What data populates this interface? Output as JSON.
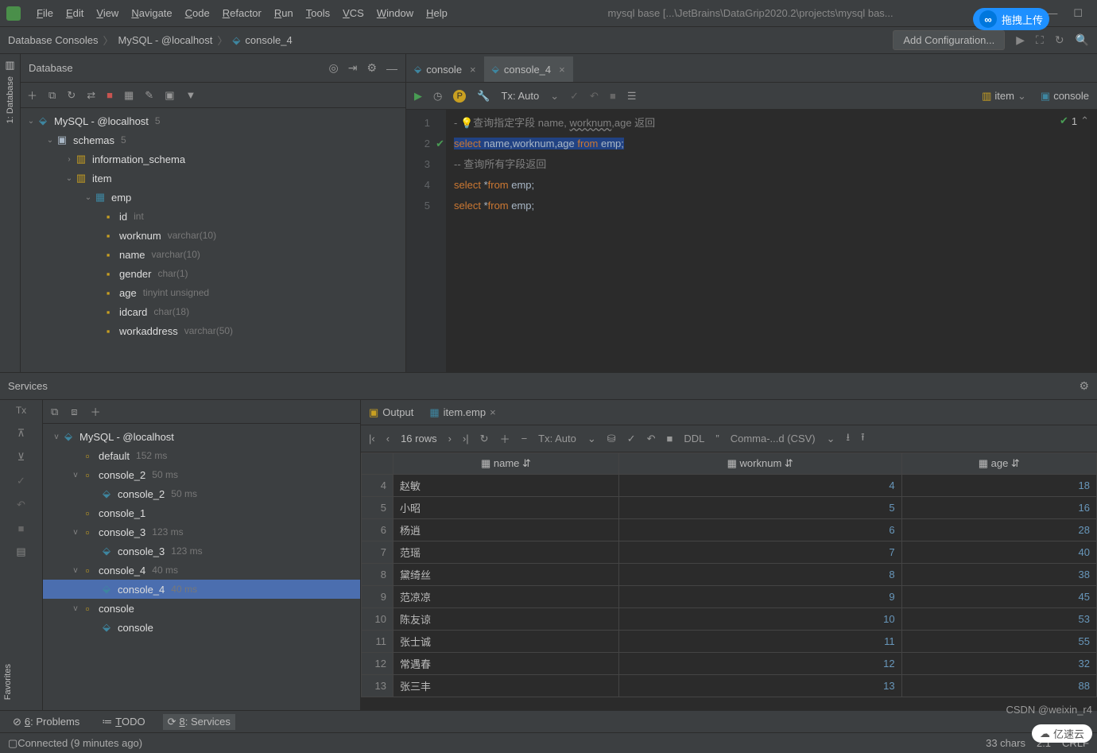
{
  "window": {
    "title": "mysql base [...\\JetBrains\\DataGrip2020.2\\projects\\mysql bas...",
    "float_button": "拖拽上传"
  },
  "menubar": [
    "File",
    "Edit",
    "View",
    "Navigate",
    "Code",
    "Refactor",
    "Run",
    "Tools",
    "VCS",
    "Window",
    "Help"
  ],
  "breadcrumb": [
    "Database Consoles",
    "MySQL - @localhost",
    "console_4"
  ],
  "config": "Add Configuration...",
  "left_tab": "1: Database",
  "db_panel": {
    "title": "Database",
    "tree": {
      "root": "MySQL - @localhost",
      "root_badge": "5",
      "schemas": "schemas",
      "schemas_badge": "5",
      "info": "information_schema",
      "item": "item",
      "emp": "emp",
      "cols": [
        {
          "n": "id",
          "t": "int"
        },
        {
          "n": "worknum",
          "t": "varchar(10)"
        },
        {
          "n": "name",
          "t": "varchar(10)"
        },
        {
          "n": "gender",
          "t": "char(1)"
        },
        {
          "n": "age",
          "t": "tinyint unsigned"
        },
        {
          "n": "idcard",
          "t": "char(18)"
        },
        {
          "n": "workaddress",
          "t": "varchar(50)"
        }
      ]
    }
  },
  "editor_tabs": [
    {
      "label": "console",
      "active": false
    },
    {
      "label": "console_4",
      "active": true
    }
  ],
  "editor_tb": {
    "tx": "Tx: Auto",
    "item": "item",
    "console": "console"
  },
  "code_lines": [
    {
      "n": 1,
      "type": "cm",
      "text": "查询指定字段 ",
      "extra": "name, ",
      "under": "worknum",
      "tail": ",age 返回",
      "bulb": true
    },
    {
      "n": 2,
      "type": "sel",
      "kw1": "select",
      "ids": " name,worknum,age ",
      "kw2": "from",
      "tbl": " emp",
      "semi": ";",
      "hl": true,
      "mark": true
    },
    {
      "n": 3,
      "type": "cm2",
      "text": "-- 查询所有字段返回"
    },
    {
      "n": 4,
      "type": "sel2",
      "kw1": "select",
      "star": " *",
      "kw2": "from",
      "tbl": " emp",
      "semi": ";"
    },
    {
      "n": 5,
      "type": "sel2",
      "kw1": "select",
      "star": " *",
      "kw2": "from",
      "tbl": " emp",
      "semi": ";"
    }
  ],
  "code_badge": "1",
  "services": {
    "title": "Services",
    "tree": [
      {
        "ind": 0,
        "exp": "v",
        "ico": "⬙",
        "label": "MySQL - @localhost",
        "hint": ""
      },
      {
        "ind": 1,
        "exp": "",
        "ico": "▫",
        "label": "default",
        "hint": "152 ms"
      },
      {
        "ind": 1,
        "exp": "v",
        "ico": "▫",
        "label": "console_2",
        "hint": "50 ms"
      },
      {
        "ind": 2,
        "exp": "",
        "ico": "⬙",
        "label": "console_2",
        "hint": "50 ms"
      },
      {
        "ind": 1,
        "exp": "",
        "ico": "▫",
        "label": "console_1",
        "hint": ""
      },
      {
        "ind": 1,
        "exp": "v",
        "ico": "▫",
        "label": "console_3",
        "hint": "123 ms"
      },
      {
        "ind": 2,
        "exp": "",
        "ico": "⬙",
        "label": "console_3",
        "hint": "123 ms"
      },
      {
        "ind": 1,
        "exp": "v",
        "ico": "▫",
        "label": "console_4",
        "hint": "40 ms"
      },
      {
        "ind": 2,
        "exp": "",
        "ico": "⬙",
        "label": "console_4",
        "hint": "40 ms",
        "sel": true
      },
      {
        "ind": 1,
        "exp": "v",
        "ico": "▫",
        "label": "console",
        "hint": ""
      },
      {
        "ind": 2,
        "exp": "",
        "ico": "⬙",
        "label": "console",
        "hint": ""
      }
    ],
    "output_tab": "Output",
    "table_tab": "item.emp",
    "rowcount": "16 rows",
    "tx": "Tx: Auto",
    "ddl": "DDL",
    "csv": "Comma-...d (CSV)",
    "columns": [
      "name",
      "worknum",
      "age"
    ],
    "rows": [
      {
        "rn": 4,
        "name": "赵敏",
        "worknum": "4",
        "age": "18"
      },
      {
        "rn": 5,
        "name": "小昭",
        "worknum": "5",
        "age": "16"
      },
      {
        "rn": 6,
        "name": "杨逍",
        "worknum": "6",
        "age": "28"
      },
      {
        "rn": 7,
        "name": "范瑶",
        "worknum": "7",
        "age": "40"
      },
      {
        "rn": 8,
        "name": "黛绮丝",
        "worknum": "8",
        "age": "38"
      },
      {
        "rn": 9,
        "name": "范凉凉",
        "worknum": "9",
        "age": "45"
      },
      {
        "rn": 10,
        "name": "陈友谅",
        "worknum": "10",
        "age": "53"
      },
      {
        "rn": 11,
        "name": "张士诚",
        "worknum": "11",
        "age": "55"
      },
      {
        "rn": 12,
        "name": "常遇春",
        "worknum": "12",
        "age": "32"
      },
      {
        "rn": 13,
        "name": "张三丰",
        "worknum": "13",
        "age": "88"
      }
    ]
  },
  "status_tabs": [
    {
      "ico": "⊘",
      "label": "6: Problems"
    },
    {
      "ico": "≔",
      "label": "TODO"
    },
    {
      "ico": "⟳",
      "label": "8: Services",
      "active": true
    }
  ],
  "bottom": {
    "status": "Connected (9 minutes ago)",
    "chars": "33 chars",
    "pos": "2:1",
    "eol": "CRLF"
  },
  "watermark": "CSDN @weixin_r4",
  "cloud": "亿速云",
  "favorites": "Favorites"
}
